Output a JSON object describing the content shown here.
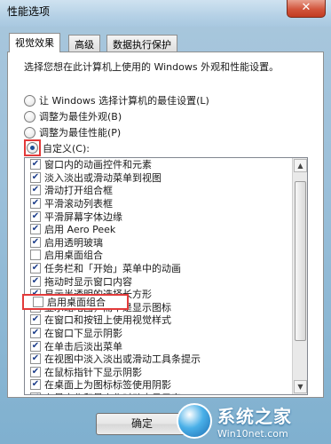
{
  "window": {
    "title": "性能选项",
    "close_glyph": "✕"
  },
  "tabs": [
    {
      "label": "视觉效果",
      "active": true
    },
    {
      "label": "高级",
      "active": false
    },
    {
      "label": "数据执行保护",
      "active": false
    }
  ],
  "intro": "选择您想在此计算机上使用的 Windows 外观和性能设置。",
  "radios": [
    {
      "label": "让 Windows 选择计算机的最佳设置(L)",
      "selected": false
    },
    {
      "label": "调整为最佳外观(B)",
      "selected": false
    },
    {
      "label": "调整为最佳性能(P)",
      "selected": false
    },
    {
      "label": "自定义(C):",
      "selected": true
    }
  ],
  "effects": [
    {
      "label": "窗口内的动画控件和元素",
      "checked": true
    },
    {
      "label": "淡入淡出或滑动菜单到视图",
      "checked": true
    },
    {
      "label": "滑动打开组合框",
      "checked": true
    },
    {
      "label": "平滑滚动列表框",
      "checked": true
    },
    {
      "label": "平滑屏幕字体边缘",
      "checked": true
    },
    {
      "label": "启用 Aero Peek",
      "checked": true
    },
    {
      "label": "启用透明玻璃",
      "checked": true
    },
    {
      "label": "启用桌面组合",
      "checked": false
    },
    {
      "label": "任务栏和「开始」菜单中的动画",
      "checked": true
    },
    {
      "label": "拖动时显示窗口内容",
      "checked": true
    },
    {
      "label": "显示半透明的选择长方形",
      "checked": true
    },
    {
      "label": "显示缩略图，而不是显示图标",
      "checked": true
    },
    {
      "label": "在窗口和按钮上使用视觉样式",
      "checked": true
    },
    {
      "label": "在窗口下显示阴影",
      "checked": true
    },
    {
      "label": "在单击后淡出菜单",
      "checked": true
    },
    {
      "label": "在视图中淡入淡出或滑动工具条提示",
      "checked": true
    },
    {
      "label": "在鼠标指针下显示阴影",
      "checked": true
    },
    {
      "label": "在桌面上为图标标签使用阴影",
      "checked": true
    },
    {
      "label": "在最大化和最小化时动态显示窗口",
      "checked": true
    }
  ],
  "check_glyph": "✔",
  "scroll_up": "▲",
  "scroll_down": "▼",
  "ok_label": "确定",
  "watermark": {
    "main": "系统之家",
    "sub": "Win10net.com"
  },
  "colors": {
    "highlight_border": "#e23a3a",
    "accent": "#1c4f97"
  }
}
